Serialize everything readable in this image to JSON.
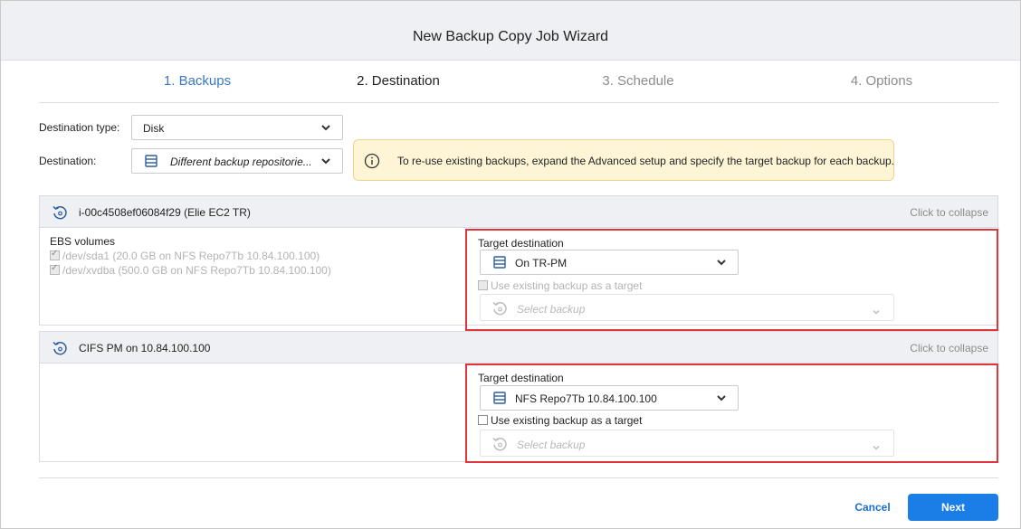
{
  "window": {
    "title": "New Backup Copy Job Wizard"
  },
  "steps": [
    "1. Backups",
    "2. Destination",
    "3. Schedule",
    "4. Options"
  ],
  "form": {
    "destination_type_label": "Destination type:",
    "destination_type_value": "Disk",
    "destination_label": "Destination:",
    "destination_value": "Different backup repositorie..."
  },
  "info": {
    "text": "To re-use existing backups, expand the Advanced setup and specify the target backup for each backup."
  },
  "sections": [
    {
      "name": "i-00c4508ef06084f29 (Elie EC2 TR)",
      "collapse_label": "Click to collapse",
      "volumes_title": "EBS volumes",
      "volumes": [
        "/dev/sda1 (20.0 GB on NFS Repo7Tb 10.84.100.100)",
        "/dev/xvdba (500.0 GB on NFS Repo7Tb 10.84.100.100)"
      ],
      "target_label": "Target destination",
      "target_value": "On TR-PM",
      "use_existing_label": "Use existing backup as a target",
      "use_existing_enabled": false,
      "select_backup_placeholder": "Select backup"
    },
    {
      "name": "CIFS PM on 10.84.100.100",
      "collapse_label": "Click to collapse",
      "target_label": "Target destination",
      "target_value": "NFS Repo7Tb 10.84.100.100",
      "use_existing_label": "Use existing backup as a target",
      "use_existing_enabled": true,
      "select_backup_placeholder": "Select backup"
    }
  ],
  "footer": {
    "cancel_label": "Cancel",
    "next_label": "Next"
  },
  "colors": {
    "accent": "#1a7ee6",
    "active_step": "#3a78c2",
    "highlight_border": "#e0353b",
    "info_bg": "#fdf5d6"
  },
  "icons": {
    "refresh": "refresh-icon",
    "repository": "database-icon",
    "info": "info-icon",
    "dropdown": "chevron-down-icon"
  }
}
